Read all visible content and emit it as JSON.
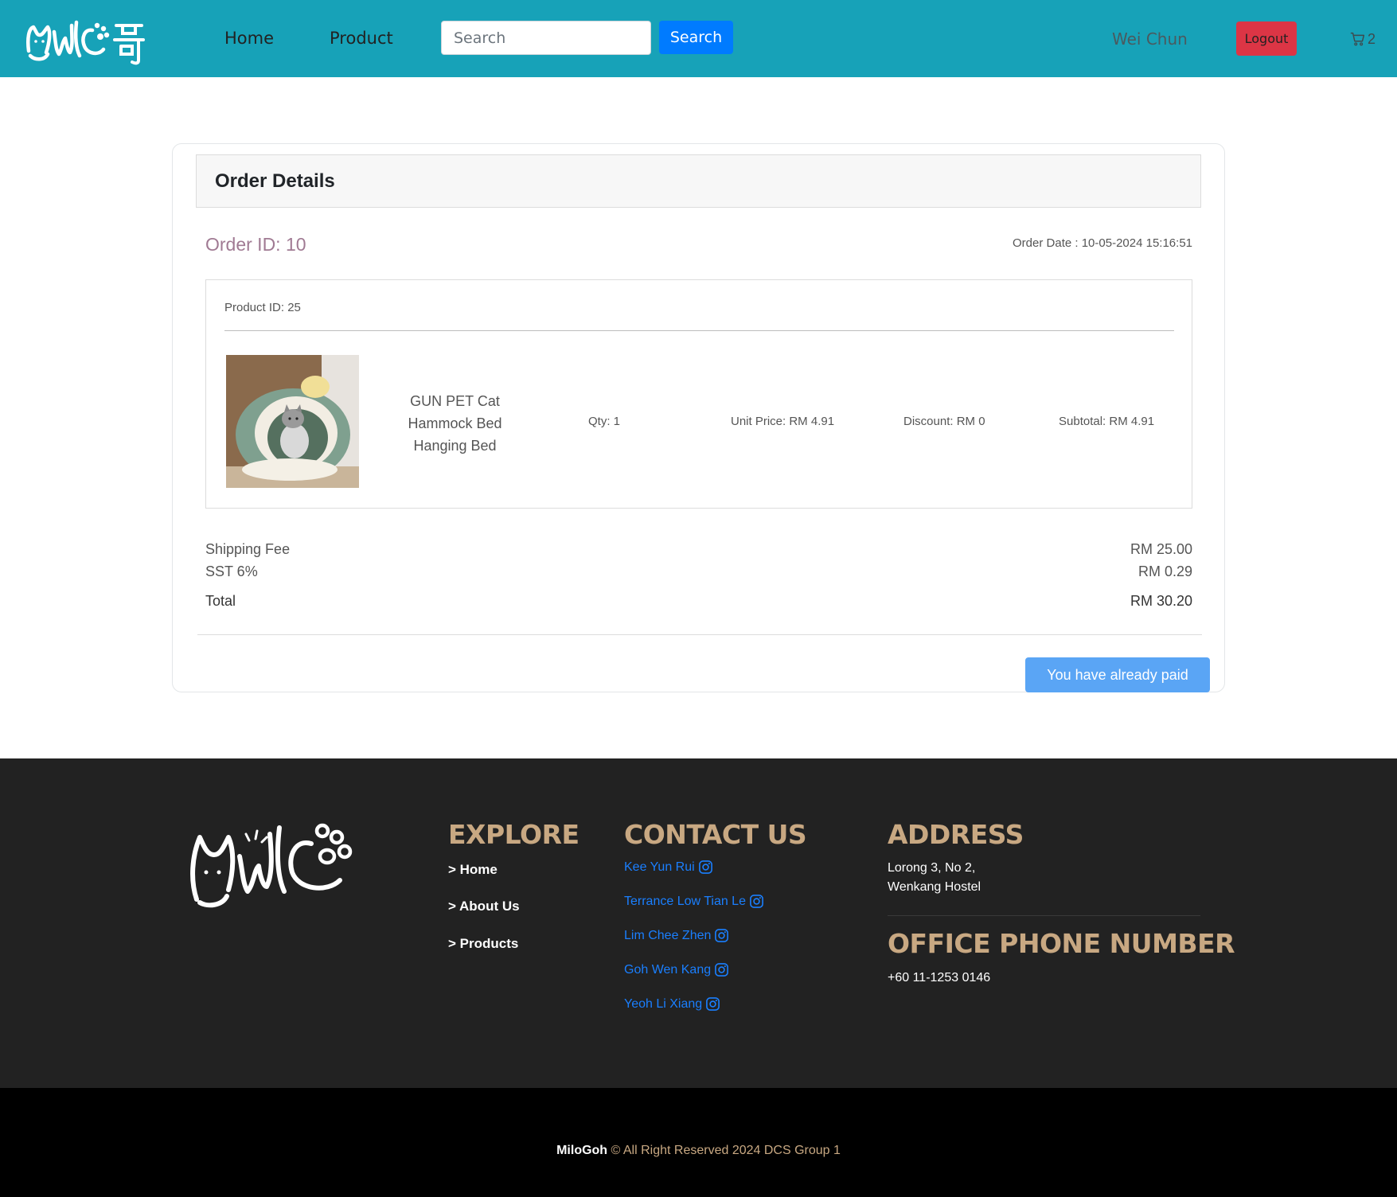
{
  "nav": {
    "logo_alt": "Milo哥",
    "home": "Home",
    "product": "Product",
    "search_placeholder": "Search",
    "search_button": "Search",
    "username": "Wei Chun",
    "logout": "Logout",
    "cart_count": "2"
  },
  "order": {
    "header_title": "Order Details",
    "order_id": "Order ID: 10",
    "order_date": "Order Date : 10-05-2024 15:16:51",
    "items": [
      {
        "product_id": "Product ID: 25",
        "name": "GUN PET Cat Hammock Bed Hanging Bed",
        "qty": "Qty: 1",
        "unit_price": "Unit Price: RM 4.91",
        "discount": "Discount: RM 0",
        "subtotal": "Subtotal: RM 4.91"
      }
    ],
    "shipping_label": "Shipping Fee",
    "shipping_value": "RM 25.00",
    "sst_label": "SST 6%",
    "sst_value": "RM 0.29",
    "total_label": "Total",
    "total_value": "RM 30.20",
    "paid_button": "You have already paid"
  },
  "footer": {
    "explore": {
      "heading": "EXPLORE",
      "links": [
        "> Home",
        "> About Us",
        "> Products"
      ]
    },
    "contact": {
      "heading": "CONTACT US",
      "people": [
        "Kee Yun Rui",
        "Terrance Low Tian Le",
        "Lim Chee Zhen",
        "Goh Wen Kang",
        "Yeoh Li Xiang"
      ]
    },
    "address": {
      "heading": "ADDRESS",
      "line1": "Lorong 3, No 2,",
      "line2": "Wenkang Hostel"
    },
    "phone": {
      "heading": "OFFICE PHONE NUMBER",
      "number": "+60 11-1253 0146"
    },
    "copyright_brand": "MiloGoh",
    "copyright_text": " © All Right Reserved 2024 DCS Group 1"
  },
  "colors": {
    "navbar": "#17a2b8",
    "search_button": "#007bff",
    "logout_button": "#dc3545",
    "paid_button": "#5aa5f5",
    "footer_bg": "#222222",
    "footer_heading": "#c8a882",
    "contact_link": "#1a7fff"
  },
  "icons": {
    "cart": "cart-icon",
    "contact": "instagram-icon"
  }
}
